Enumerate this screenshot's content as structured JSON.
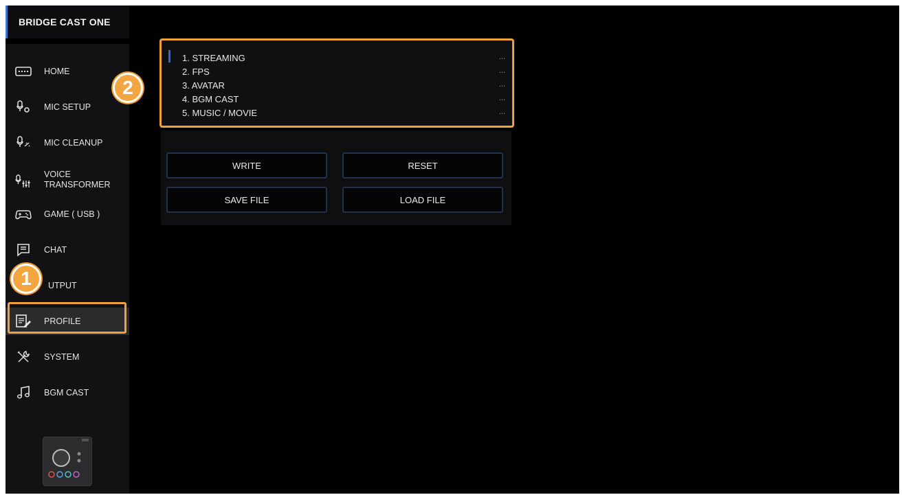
{
  "app": {
    "title": "BRIDGE CAST ONE"
  },
  "sidebar": {
    "items": [
      {
        "label": "HOME",
        "icon": "keyboard-icon"
      },
      {
        "label": "MIC SETUP",
        "icon": "mic-gear-icon"
      },
      {
        "label": "MIC CLEANUP",
        "icon": "mic-clean-icon"
      },
      {
        "label": "VOICE\nTRANSFORMER",
        "icon": "mic-sliders-icon"
      },
      {
        "label": "GAME ( USB )",
        "icon": "gamepad-icon"
      },
      {
        "label": "CHAT",
        "icon": "chat-icon"
      },
      {
        "label": "UTPUT",
        "icon": "output-icon"
      },
      {
        "label": "PROFILE",
        "icon": "profile-edit-icon"
      },
      {
        "label": "SYSTEM",
        "icon": "tools-icon"
      },
      {
        "label": "BGM CAST",
        "icon": "music-note-icon"
      }
    ],
    "active_item": "PROFILE"
  },
  "profiles": [
    {
      "label": "1. STREAMING",
      "menu": "..."
    },
    {
      "label": "2. FPS",
      "menu": "..."
    },
    {
      "label": "3. AVATAR",
      "menu": "..."
    },
    {
      "label": "4. BGM CAST",
      "menu": "..."
    },
    {
      "label": "5. MUSIC / MOVIE",
      "menu": "..."
    }
  ],
  "actions": {
    "write": "WRITE",
    "reset": "RESET",
    "save_file": "SAVE FILE",
    "load_file": "LOAD FILE"
  },
  "callouts": {
    "one": "1",
    "two": "2"
  },
  "colors": {
    "highlight": "#f0a23a",
    "accent_blue": "#3d63d8",
    "background": "#000000"
  }
}
